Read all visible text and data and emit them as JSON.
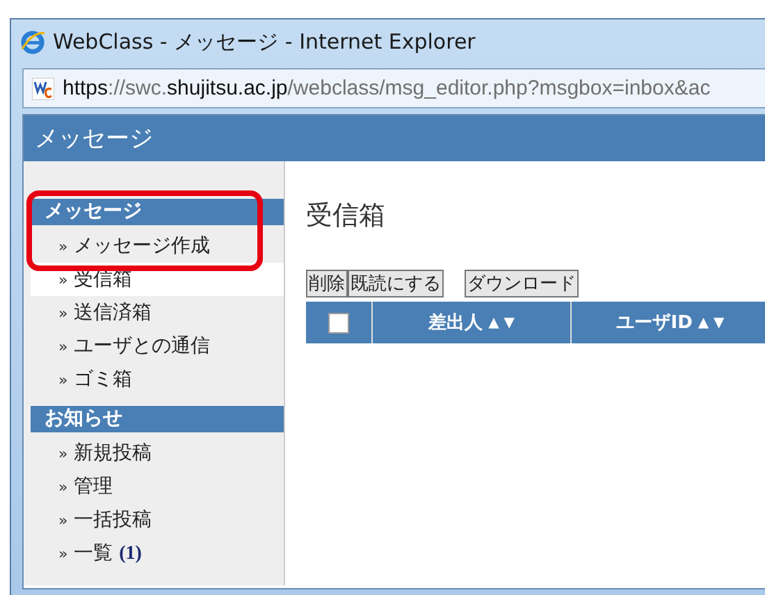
{
  "browser": {
    "title": "WebClass - メッセージ - Internet Explorer",
    "url_parts": [
      {
        "text": "https",
        "strong": true
      },
      {
        "text": "://swc.",
        "strong": false
      },
      {
        "text": "shujitsu.ac.jp",
        "strong": true
      },
      {
        "text": "/webclass/msg_editor.php?msgbox=inbox&ac",
        "strong": false
      }
    ]
  },
  "app": {
    "title": "メッセージ"
  },
  "sidebar": {
    "sections": [
      {
        "title": "メッセージ",
        "items": [
          {
            "marker": "»",
            "label": "メッセージ作成",
            "selected": false
          },
          {
            "marker": "»",
            "label": "受信箱",
            "selected": true
          },
          {
            "marker": "»",
            "label": "送信済箱",
            "selected": false
          },
          {
            "marker": "»",
            "label": "ユーザとの通信",
            "selected": false
          },
          {
            "marker": "»",
            "label": "ゴミ箱",
            "selected": false
          }
        ]
      },
      {
        "title": "お知らせ",
        "items": [
          {
            "marker": "»",
            "label": "新規投稿",
            "selected": false
          },
          {
            "marker": "»",
            "label": "管理",
            "selected": false
          },
          {
            "marker": "»",
            "label": "一括投稿",
            "selected": false
          },
          {
            "marker": "»",
            "label": "一覧 **(1)**",
            "selected": false
          }
        ]
      }
    ]
  },
  "main": {
    "title": "受信箱",
    "buttons": [
      "削除",
      "既読にする",
      "ダウンロード"
    ],
    "table": {
      "select_all": {
        "checked": false
      },
      "columns": [
        {
          "label": "差出人",
          "sort": "▲ ▼"
        },
        {
          "label": "ユーザID",
          "sort": "▲ ▼"
        }
      ]
    }
  }
}
